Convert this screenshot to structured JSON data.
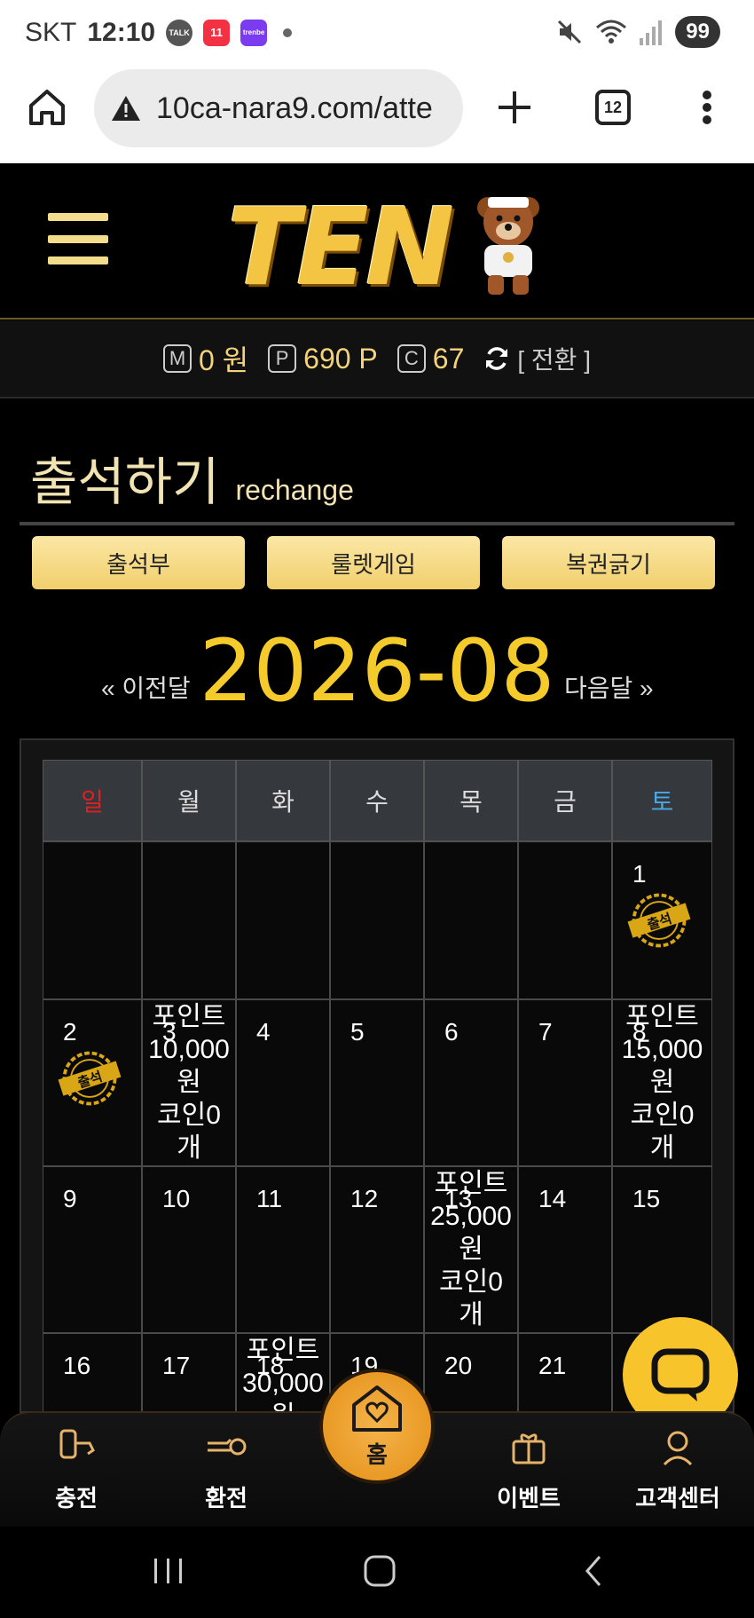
{
  "status_bar": {
    "carrier": "SKT",
    "time": "12:10",
    "app_icons": [
      "TALK",
      "11",
      "trenbe"
    ],
    "battery": "99"
  },
  "browser": {
    "url": "10ca-nara9.com/atte",
    "tab_count": "12"
  },
  "site": {
    "logo_text": "TEN",
    "balance": {
      "money_badge": "M",
      "money": "0 원",
      "point_badge": "P",
      "point": "690 P",
      "coin_badge": "C",
      "coin": "67",
      "switch_label": "[ 전환 ]"
    }
  },
  "page": {
    "title": "출석하기",
    "subtitle": "rechange",
    "tabs": [
      "출석부",
      "룰렛게임",
      "복권긁기"
    ],
    "prev_month": "« 이전달",
    "next_month": "다음달 »",
    "month": "2026-08"
  },
  "calendar": {
    "weekdays": [
      "일",
      "월",
      "화",
      "수",
      "목",
      "금",
      "토"
    ],
    "weekday_colors": {
      "sun": "#e02020",
      "sat": "#4aa8e8",
      "other": "#dddddd"
    },
    "stamp_text": "출석",
    "rows": [
      [
        "",
        "",
        "",
        "",
        "",
        "",
        "1"
      ],
      [
        "2",
        "3",
        "4",
        "5",
        "6",
        "7",
        "8"
      ],
      [
        "9",
        "10",
        "11",
        "12",
        "13",
        "14",
        "15"
      ],
      [
        "16",
        "17",
        "18",
        "19",
        "20",
        "21",
        ""
      ]
    ],
    "stamped_days": [
      "1",
      "2"
    ],
    "rewards": {
      "3": [
        "포인트",
        "10,000",
        "원",
        "코인0",
        "개"
      ],
      "8": [
        "포인트",
        "15,000",
        "원",
        "코인0",
        "개"
      ],
      "13": [
        "포인트",
        "25,000",
        "원",
        "코인0",
        "개"
      ],
      "18": [
        "포인트",
        "30,000",
        "원"
      ]
    }
  },
  "bottom_nav": {
    "charge": "충전",
    "exchange": "환전",
    "home": "홈",
    "event": "이벤트",
    "support": "고객센터"
  },
  "colors": {
    "accent_gold": "#f5cb2c",
    "button_gold": "#f1cf6c",
    "home_orange": "#e58f15"
  }
}
